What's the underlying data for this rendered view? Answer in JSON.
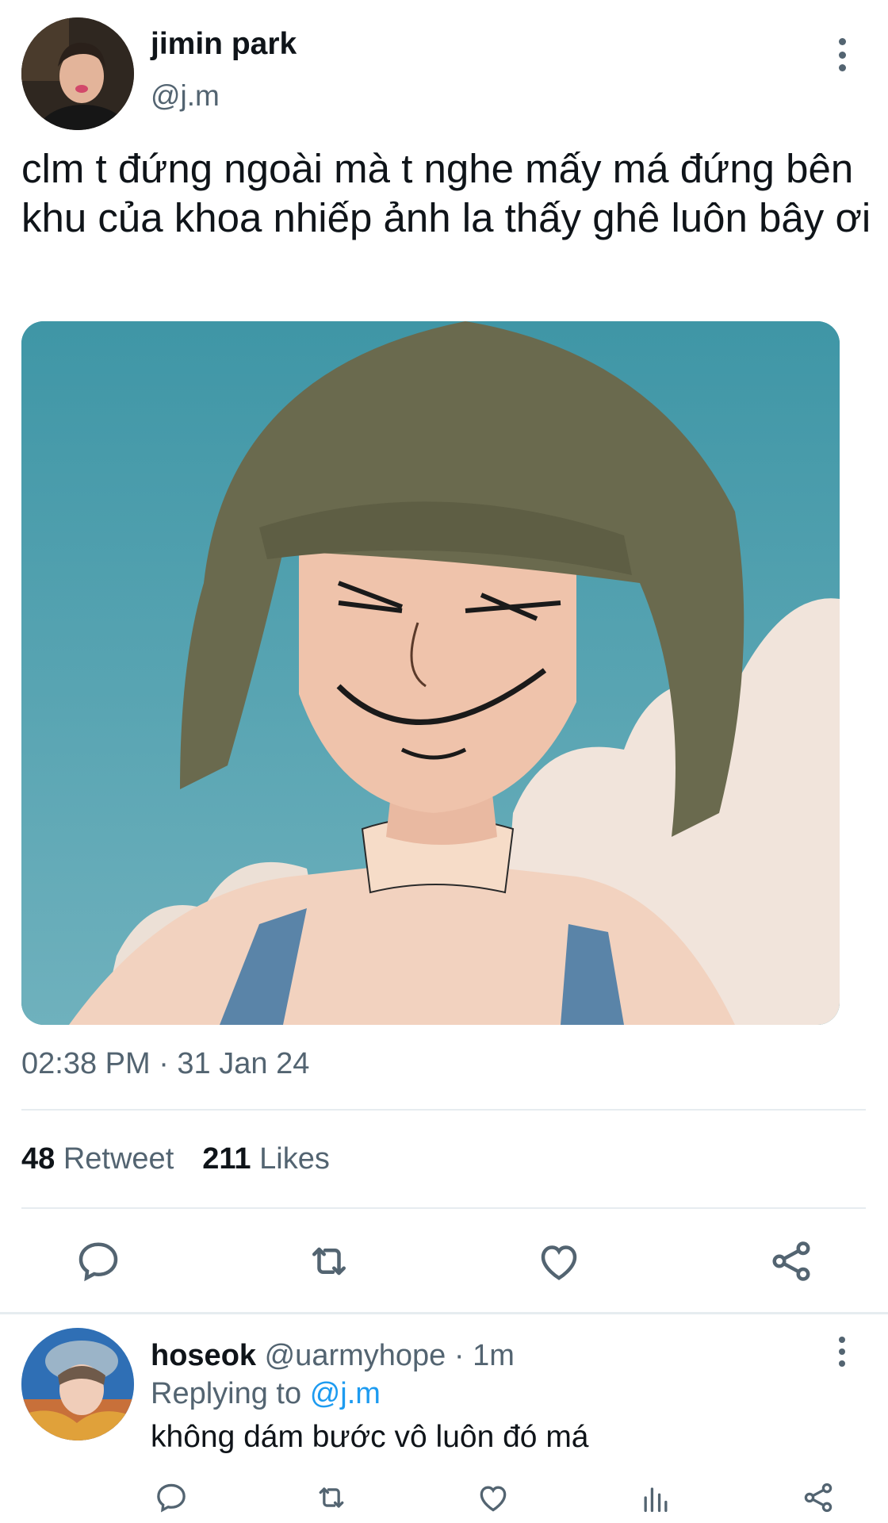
{
  "tweet": {
    "display_name": "jimin park",
    "handle": "@j.m",
    "text": "clm t đứng ngoài mà t nghe mấy má đứng bên khu của khoa nhiếp ảnh la thấy ghê luôn bây ơi",
    "timestamp": "02:38 PM · 31 Jan 24",
    "retweet_count": "48",
    "retweet_label": "Retweet",
    "like_count": "211",
    "like_label": "Likes"
  },
  "reply": {
    "display_name": "hoseok",
    "handle": "@uarmyhope",
    "time": "· 1m",
    "replying_prefix": "Replying to",
    "replying_handle": "@j.m",
    "text": "không dám bước vô luôn đó má"
  },
  "icons": {
    "reply": "reply-icon",
    "retweet": "retweet-icon",
    "like": "heart-icon",
    "share": "share-icon",
    "views": "analytics-icon",
    "more": "more-icon"
  },
  "colors": {
    "text": "#0f1419",
    "secondary": "#536471",
    "link": "#1d9bf0",
    "divider": "#e6ecf0"
  }
}
